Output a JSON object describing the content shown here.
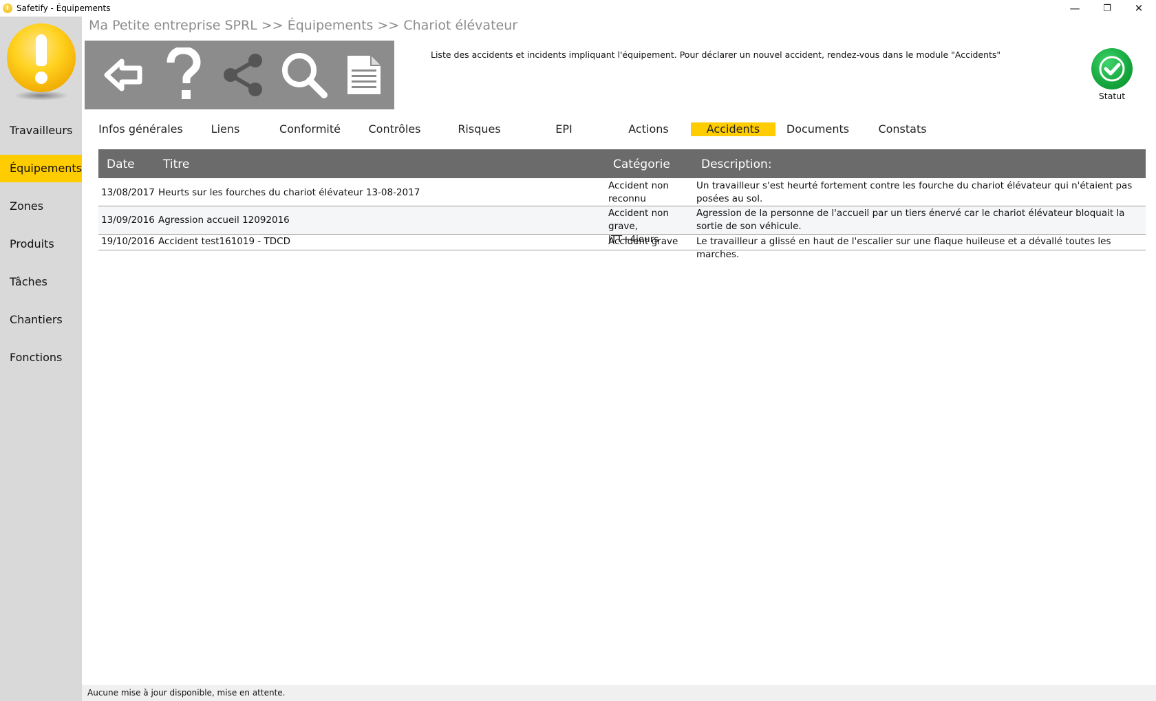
{
  "window": {
    "title": "Safetify - Équipements",
    "controls": {
      "minimize": "—",
      "restore": "❐",
      "close": "✕"
    }
  },
  "colors": {
    "accent": "#ffcc00",
    "sidebar": "#d9d9d9",
    "toolbar": "#8c8c8c",
    "grid_header": "#6b6b6b",
    "status_ok": "#14a63c"
  },
  "sidebar": {
    "items": [
      {
        "label": "Travailleurs",
        "active": false
      },
      {
        "label": "Équipements",
        "active": true
      },
      {
        "label": "Zones",
        "active": false
      },
      {
        "label": "Produits",
        "active": false
      },
      {
        "label": "Tâches",
        "active": false
      },
      {
        "label": "Chantiers",
        "active": false
      },
      {
        "label": "Fonctions",
        "active": false
      }
    ]
  },
  "breadcrumb": "Ma Petite entreprise SPRL >> Équipements >> Chariot élévateur",
  "toolbar": {
    "icons": [
      "back-arrow-icon",
      "help-icon",
      "share-icon",
      "search-icon",
      "document-icon"
    ]
  },
  "info_text": "Liste des accidents et incidents impliquant l'équipement. Pour déclarer un nouvel accident, rendez-vous dans le module \"Accidents\"",
  "status": {
    "label": "Statut",
    "icon": "check-circle-icon"
  },
  "tabs": [
    {
      "label": "Infos générales",
      "active": false
    },
    {
      "label": "Liens",
      "active": false
    },
    {
      "label": "Conformité",
      "active": false
    },
    {
      "label": "Contrôles",
      "active": false
    },
    {
      "label": "Risques",
      "active": false
    },
    {
      "label": "EPI",
      "active": false
    },
    {
      "label": "Actions",
      "active": false
    },
    {
      "label": "Accidents",
      "active": true
    },
    {
      "label": "Documents",
      "active": false
    },
    {
      "label": "Constats",
      "active": false
    }
  ],
  "grid": {
    "headers": {
      "date": "Date",
      "title": "Titre",
      "category": "Catégorie",
      "description": "Description:"
    },
    "rows": [
      {
        "date": "13/08/2017",
        "title": "Heurts sur les fourches du chariot élévateur 13-08-2017",
        "category": "Accident non reconnu",
        "description": "Un travailleur s'est heurté fortement contre les fourche du chariot élévateur qui n'étaient pas posées au sol."
      },
      {
        "date": "13/09/2016",
        "title": "Agression accueil 12092016",
        "category": "Accident non grave, ITT+4jours",
        "description": "Agression de la personne de l'accueil par un tiers énervé car le chariot élévateur bloquait la sortie de son véhicule."
      },
      {
        "date": "19/10/2016",
        "title": "Accident test161019 - TDCD",
        "category": "Accident grave",
        "description": "Le travailleur a glissé en haut de l'escalier sur une flaque huileuse et a dévallé toutes les marches."
      }
    ]
  },
  "statusbar": "Aucune mise à jour disponible, mise en attente."
}
